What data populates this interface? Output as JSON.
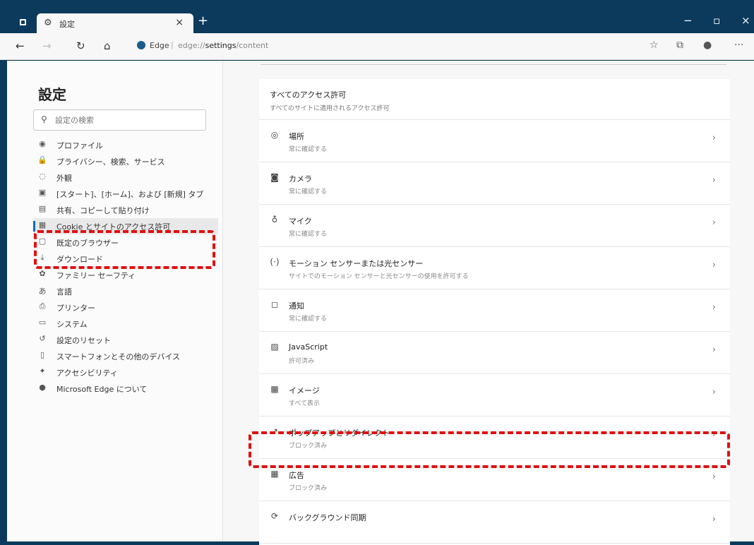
{
  "tab": {
    "title": "設定",
    "close": "×"
  },
  "window_controls": {
    "new_tab": "+",
    "minimize": "−",
    "maximize": "▫",
    "close": "×"
  },
  "toolbar": {
    "back": "←",
    "forward": "→",
    "refresh": "↻",
    "home": "⌂",
    "address_label": "Edge",
    "address_sep": "|",
    "address_prefix": "edge://",
    "address_bold": "settings",
    "address_suffix": "/content",
    "more": "···"
  },
  "sidebar": {
    "title": "設定",
    "search_placeholder": "設定の検索",
    "items": [
      {
        "icon": "◉",
        "label": "プロファイル"
      },
      {
        "icon": "🔒",
        "label": "プライバシー、検索、サービス"
      },
      {
        "icon": "◌",
        "label": "外観"
      },
      {
        "icon": "▣",
        "label": "[スタート]、[ホーム]、および [新規] タブ"
      },
      {
        "icon": "▤",
        "label": "共有、コピーして貼り付け"
      },
      {
        "icon": "▦",
        "label": "Cookie とサイトのアクセス許可"
      },
      {
        "icon": "▢",
        "label": "既定のブラウザー"
      },
      {
        "icon": "⤓",
        "label": "ダウンロード"
      },
      {
        "icon": "✿",
        "label": "ファミリー セーフティ"
      },
      {
        "icon": "あ",
        "label": "言語"
      },
      {
        "icon": "⎙",
        "label": "プリンター"
      },
      {
        "icon": "▭",
        "label": "システム"
      },
      {
        "icon": "↺",
        "label": "設定のリセット"
      },
      {
        "icon": "▯",
        "label": "スマートフォンとその他のデバイス"
      },
      {
        "icon": "✦",
        "label": "アクセシビリティ"
      },
      {
        "icon": "●",
        "label": "Microsoft Edge について"
      }
    ],
    "active_index": 5
  },
  "main": {
    "card_title": "すべてのアクセス許可",
    "card_sub": "すべてのサイトに適用されるアクセス許可",
    "permissions": [
      {
        "icon": "◎",
        "title": "場所",
        "sub": "常に確認する"
      },
      {
        "icon": "◙",
        "title": "カメラ",
        "sub": "常に確認する"
      },
      {
        "icon": "♁",
        "title": "マイク",
        "sub": "常に確認する"
      },
      {
        "icon": "(·)",
        "title": "モーション センサーまたは光センサー",
        "sub": "サイトでのモーション センサーと光センサーの使用を許可する"
      },
      {
        "icon": "◻",
        "title": "通知",
        "sub": "常に確認する"
      },
      {
        "icon": "▨",
        "title": "JavaScript",
        "sub": "許可済み"
      },
      {
        "icon": "▩",
        "title": "イメージ",
        "sub": "すべて表示"
      },
      {
        "icon": "↗",
        "title": "ポップアップとリダイレクト",
        "sub": "ブロック済み"
      },
      {
        "icon": "▦",
        "title": "広告",
        "sub": "ブロック済み"
      },
      {
        "icon": "⟳",
        "title": "バックグラウンド同期",
        "sub": ""
      }
    ],
    "chevron": "›"
  },
  "colors": {
    "annotation": "#e01010",
    "titlebar": "#0b3a5c",
    "accent": "#0f6cbd"
  }
}
